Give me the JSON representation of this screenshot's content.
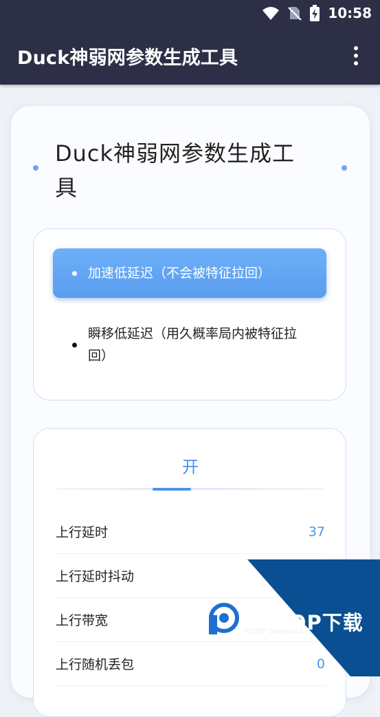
{
  "status_bar": {
    "time": "10:58",
    "icons": [
      "wifi-icon",
      "no-sim-icon",
      "battery-charging-icon"
    ]
  },
  "app_bar": {
    "title": "Duck神弱网参数生成工具",
    "menu_icon": "more-vert-icon"
  },
  "card": {
    "heading": "Duck神弱网参数生成工具"
  },
  "modes": [
    {
      "label": "加速低延迟（不会被特征拉回）",
      "selected": true
    },
    {
      "label": "瞬移低延迟（用久概率局内被特征拉回）",
      "selected": false
    }
  ],
  "toggle": {
    "label": "开"
  },
  "params": [
    {
      "name": "上行延时",
      "value": "37"
    },
    {
      "name": "上行延时抖动",
      "value": ""
    },
    {
      "name": "上行带宽",
      "value": ""
    },
    {
      "name": "上行随机丢包",
      "value": "0"
    }
  ],
  "watermark": {
    "brand": "PCPOP下载",
    "sub": "PCPOP Download"
  },
  "colors": {
    "app_bar": "#2c2f45",
    "accent": "#4a93e8",
    "selected_mode": "#62a6f4",
    "watermark_blue": "#0a4f92"
  }
}
